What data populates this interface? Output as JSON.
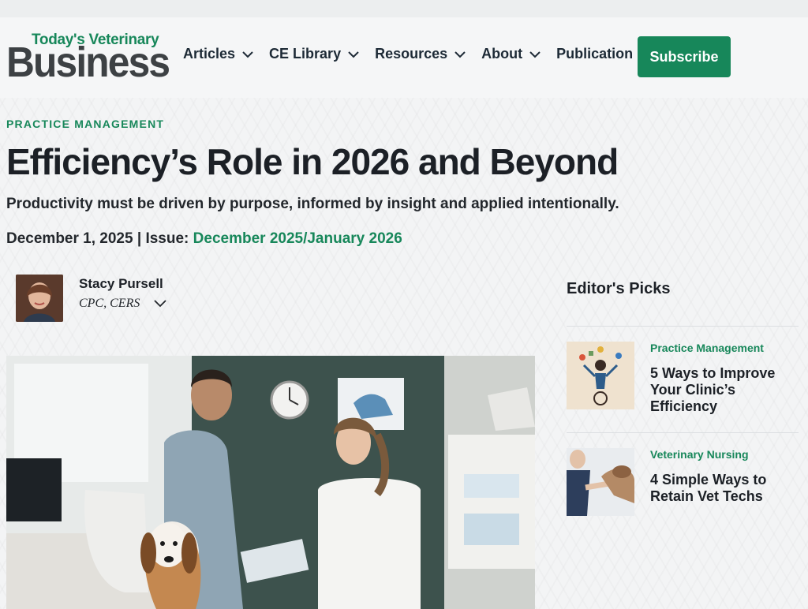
{
  "brand": {
    "logo_top": "Today's Veterinary",
    "logo_main": "Business"
  },
  "nav": {
    "items": [
      {
        "label": "Articles"
      },
      {
        "label": "CE Library"
      },
      {
        "label": "Resources"
      },
      {
        "label": "About"
      },
      {
        "label": "Publication"
      }
    ],
    "subscribe_label": "Subscribe"
  },
  "article": {
    "category": "PRACTICE MANAGEMENT",
    "title": "Efficiency’s Role in 2026 and Beyond",
    "subtitle": "Productivity must be driven by purpose, informed by insight and applied intentionally.",
    "date": "December 1, 2025",
    "separator": "|",
    "issue_label": "Issue:",
    "issue_value": "December 2025/January 2026",
    "author": {
      "name": "Stacy Pursell",
      "credentials": "CPC, CERS"
    }
  },
  "sidebar": {
    "heading": "Editor's Picks",
    "picks": [
      {
        "category": "Practice Management",
        "title": "5 Ways to Improve Your Clinic’s Efficiency"
      },
      {
        "category": "Veterinary Nursing",
        "title": "4 Simple Ways to Retain Vet Techs"
      }
    ]
  },
  "colors": {
    "accent": "#17875a",
    "text": "#1c2026",
    "logo_gray": "#3d4144"
  },
  "icons": {
    "nav_dropdown": "chevron-down-icon",
    "author_expand": "chevron-down-icon"
  }
}
